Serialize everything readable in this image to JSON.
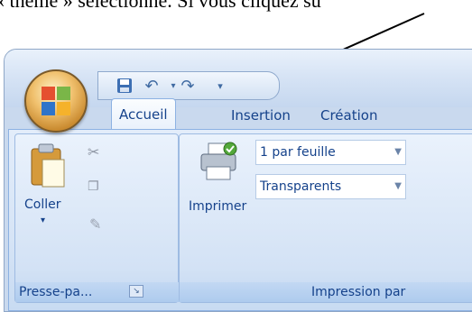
{
  "document": {
    "text": "« thème » sélectionné. Si vous cliquez su"
  },
  "titlebar": {
    "qat_items": [
      "save-icon",
      "undo-icon",
      "redo-icon",
      "customize-icon"
    ]
  },
  "tabs": [
    {
      "label": "Accueil",
      "active": true
    },
    {
      "label": "Insertion",
      "active": false
    },
    {
      "label": "Création",
      "active": false
    }
  ],
  "ribbon": {
    "clipboard": {
      "paste_label": "Coller",
      "group_label": "Presse-pa..."
    },
    "print": {
      "print_label": "Imprimer",
      "combo1": "1 par feuille",
      "combo2": "Transparents",
      "group_label": "Impression par"
    }
  },
  "colors": {
    "accent": "#15428b",
    "ribbon_bg": "#d6e4f6"
  }
}
